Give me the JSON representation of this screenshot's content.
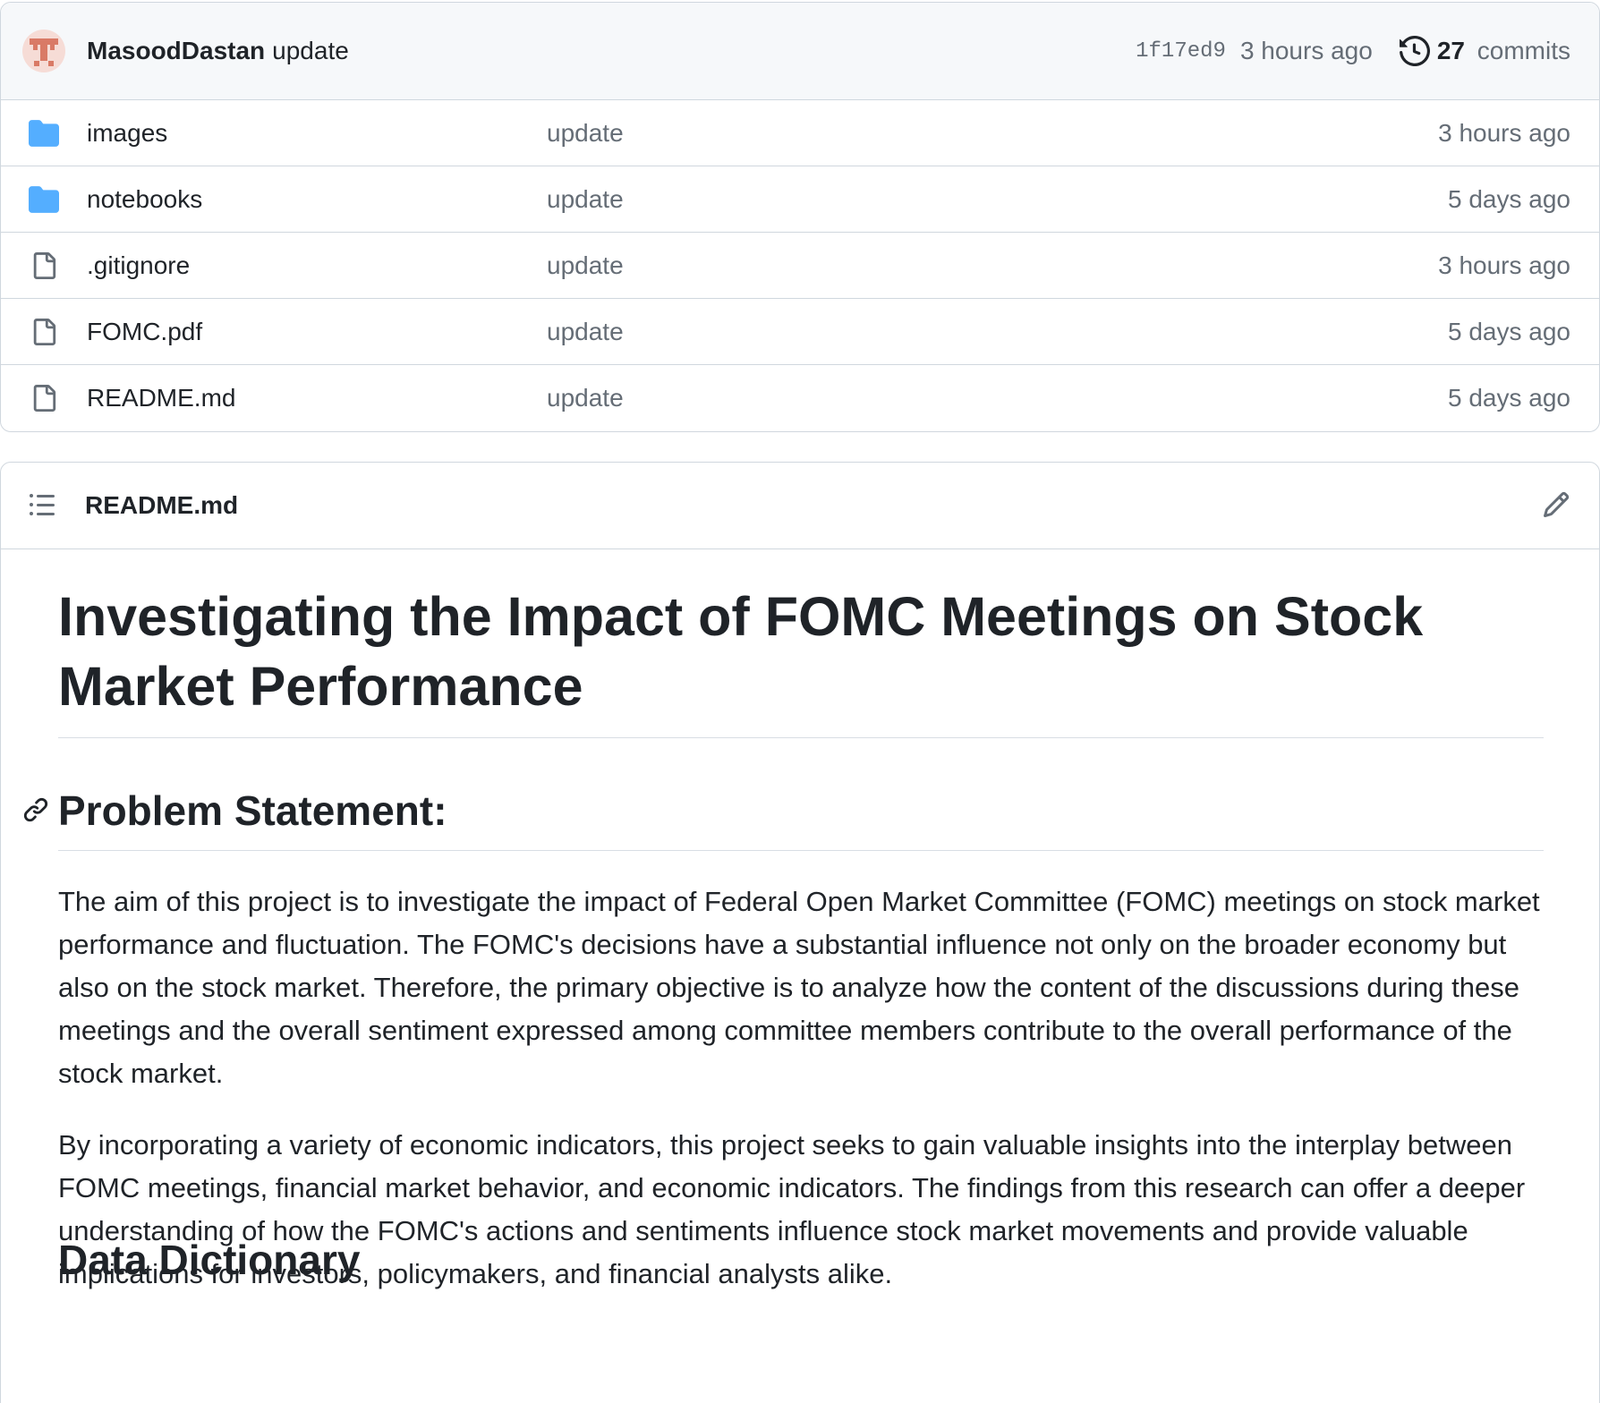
{
  "latest_commit": {
    "author": "MasoodDastan",
    "message": "update",
    "sha": "1f17ed9",
    "time": "3 hours ago",
    "commit_count": "27",
    "commit_count_label": "commits",
    "avatar_icon": "identicon-avatar",
    "avatar_color": "#d97a66"
  },
  "files": [
    {
      "name": "images",
      "type": "folder",
      "icon": "folder-icon",
      "commit": "update",
      "time": "3 hours ago"
    },
    {
      "name": "notebooks",
      "type": "folder",
      "icon": "folder-icon",
      "commit": "update",
      "time": "5 days ago"
    },
    {
      "name": ".gitignore",
      "type": "file",
      "icon": "file-icon",
      "commit": "update",
      "time": "3 hours ago"
    },
    {
      "name": "FOMC.pdf",
      "type": "file",
      "icon": "file-icon",
      "commit": "update",
      "time": "5 days ago"
    },
    {
      "name": "README.md",
      "type": "file",
      "icon": "file-icon",
      "commit": "update",
      "time": "5 days ago"
    }
  ],
  "readme": {
    "filename": "README.md",
    "title": "Investigating the Impact of FOMC Meetings on Stock Market Performance",
    "section1_heading": "Problem Statement:",
    "paragraph1": "The aim of this project is to investigate the impact of Federal Open Market Committee (FOMC) meetings on stock market performance and fluctuation. The FOMC's decisions have a substantial influence not only on the broader economy but also on the stock market. Therefore, the primary objective is to analyze how the content of the discussions during these meetings and the overall sentiment expressed among committee members contribute to the overall performance of the stock market.",
    "paragraph2": "By incorporating a variety of economic indicators, this project seeks to gain valuable insights into the interplay between FOMC meetings, financial market behavior, and economic indicators. The findings from this research can offer a deeper understanding of how the FOMC's actions and sentiments influence stock market movements and provide valuable implications for investors, policymakers, and financial analysts alike.",
    "section2_heading": "Data Dictionary"
  },
  "colors": {
    "folder": "#54aeff",
    "text_primary": "#1f2328",
    "text_muted": "#656d76",
    "border": "#d0d7de",
    "header_bg": "#f6f8fa"
  }
}
